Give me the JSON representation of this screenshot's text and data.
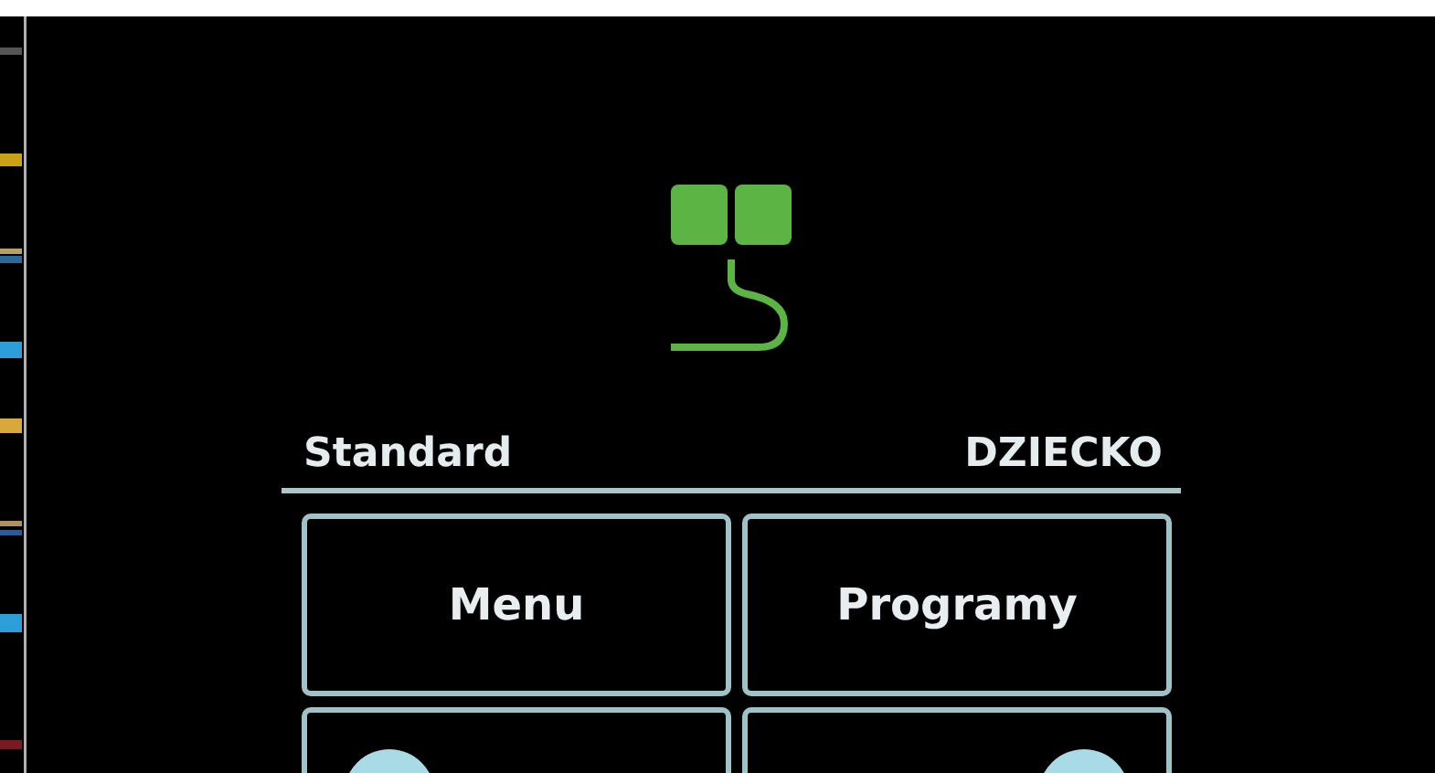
{
  "profile": {
    "mode": "Standard",
    "user": "DZIECKO"
  },
  "buttons": [
    {
      "label": "Menu"
    },
    {
      "label": "Programy"
    }
  ]
}
